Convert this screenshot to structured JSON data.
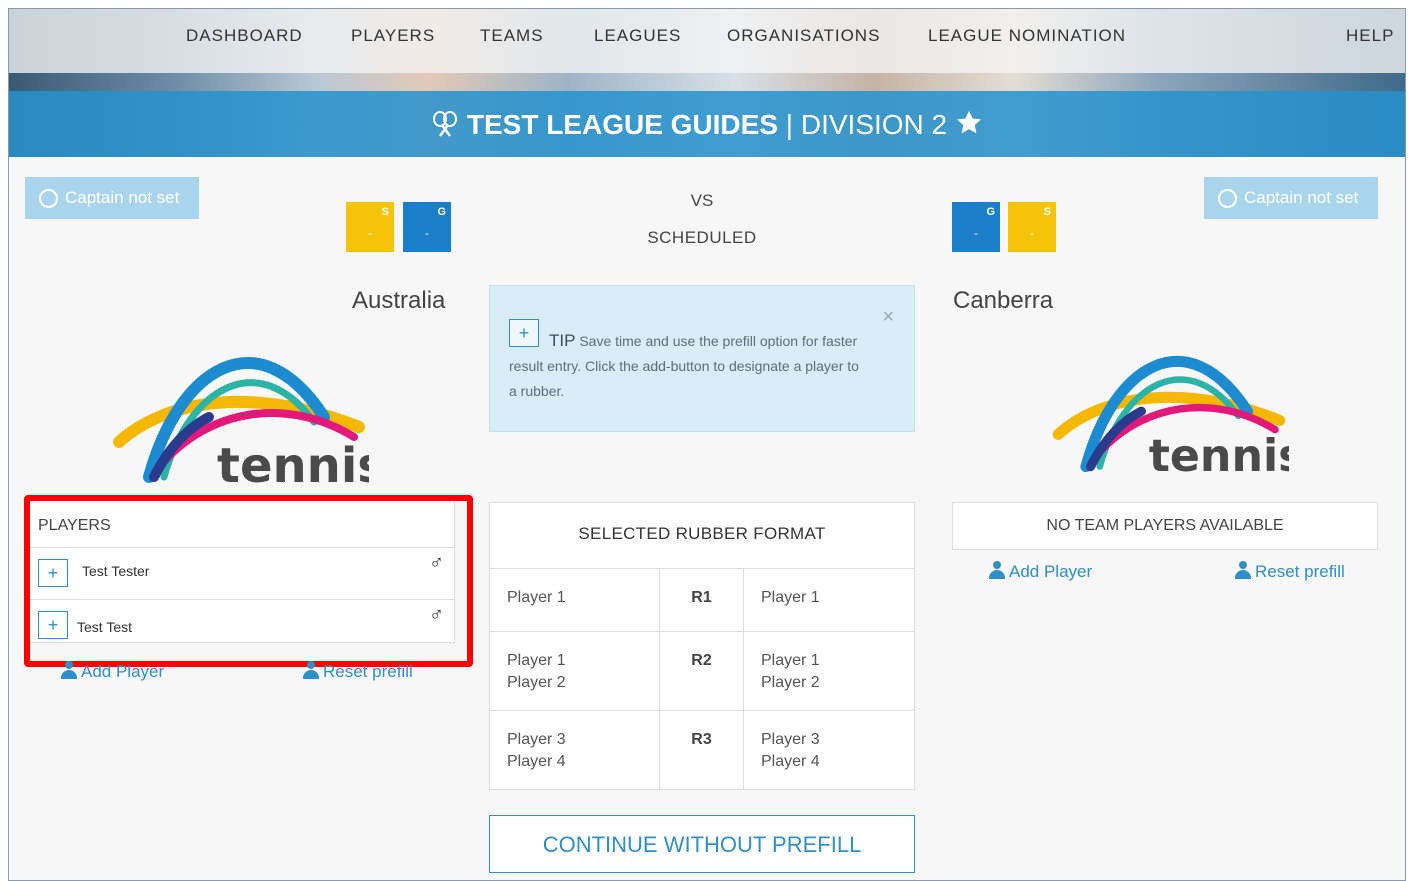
{
  "nav": {
    "items": [
      "DASHBOARD",
      "PLAYERS",
      "TEAMS",
      "LEAGUES",
      "ORGANISATIONS",
      "LEAGUE NOMINATION",
      "HELP"
    ]
  },
  "header": {
    "league_title": "TEST LEAGUE GUIDES",
    "separator": "|",
    "division": "DIVISION 2"
  },
  "match": {
    "vs": "VS",
    "status": "SCHEDULED"
  },
  "home": {
    "captain_label": "Captain not set",
    "team_name": "Australia",
    "badges": [
      {
        "letter": "S",
        "value": "-",
        "color": "#f5c30a"
      },
      {
        "letter": "G",
        "value": "-",
        "color": "#1a7fc8"
      }
    ],
    "logo_text": "tennis",
    "players_header": "PLAYERS",
    "players": [
      {
        "name": "Test Tester",
        "gender_symbol": "♂"
      },
      {
        "name": "Test Test",
        "gender_symbol": "♂"
      }
    ],
    "add_player": "Add Player",
    "reset_prefill": "Reset prefill"
  },
  "away": {
    "captain_label": "Captain not set",
    "team_name": "Canberra",
    "badges": [
      {
        "letter": "G",
        "value": "-",
        "color": "#1a7fc8"
      },
      {
        "letter": "S",
        "value": "-",
        "color": "#f5c30a"
      }
    ],
    "logo_text": "tennis",
    "no_players": "NO TEAM PLAYERS AVAILABLE",
    "add_player": "Add Player",
    "reset_prefill": "Reset prefill"
  },
  "tip": {
    "plus": "+",
    "label": "TIP",
    "text": "Save time and use the prefill option for faster result entry. Click the add-button to designate a player to a rubber.",
    "close": "×"
  },
  "rubber_format": {
    "title": "SELECTED RUBBER FORMAT",
    "rows": [
      {
        "left": "Player 1",
        "rubber": "R1",
        "right": "Player 1"
      },
      {
        "left": "Player 1\nPlayer 2",
        "rubber": "R2",
        "right": "Player 1\nPlayer 2"
      },
      {
        "left": "Player 3\nPlayer 4",
        "rubber": "R3",
        "right": "Player 3\nPlayer 4"
      }
    ]
  },
  "continue_button": "CONTINUE WITHOUT PREFILL",
  "colors": {
    "accent": "#2e8fc9",
    "band": "#2792cd",
    "captain_button": "#a9d5ec",
    "highlight": "#ff0000"
  }
}
